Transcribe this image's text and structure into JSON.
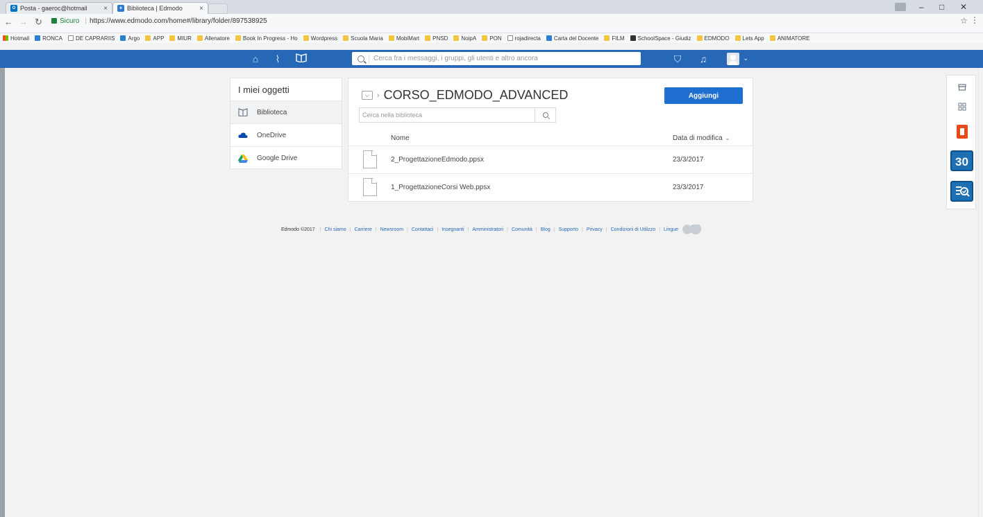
{
  "browser": {
    "tabs": [
      {
        "label": "Posta - gaeroc@hotmail",
        "favicon_color": "#0072c6",
        "favicon_text": "O"
      },
      {
        "label": "Biblioteca | Edmodo",
        "favicon_color": "#2b79d2",
        "favicon_text": "e"
      }
    ],
    "secure_label": "Sicuro",
    "url": "https://www.edmodo.com/home#/library/folder/897538925",
    "bookmarks": [
      {
        "label": "Hotmail",
        "icon": "multi"
      },
      {
        "label": "RONCA",
        "icon": "blue"
      },
      {
        "label": "DE CAPRARIIS",
        "icon": "page"
      },
      {
        "label": "Argo",
        "icon": "blue"
      },
      {
        "label": "APP",
        "icon": "folder"
      },
      {
        "label": "MIUR",
        "icon": "folder"
      },
      {
        "label": "Allenatore",
        "icon": "folder"
      },
      {
        "label": "Book In Progress - Ho",
        "icon": "folder"
      },
      {
        "label": "Wordpress",
        "icon": "folder"
      },
      {
        "label": "Scuola Maria",
        "icon": "folder"
      },
      {
        "label": "MobiMart",
        "icon": "folder"
      },
      {
        "label": "PNSD",
        "icon": "folder"
      },
      {
        "label": "NoipA",
        "icon": "folder"
      },
      {
        "label": "PON",
        "icon": "folder"
      },
      {
        "label": "rojadirecta",
        "icon": "page"
      },
      {
        "label": "Carta del Docente",
        "icon": "blue"
      },
      {
        "label": "FILM",
        "icon": "folder"
      },
      {
        "label": "SchoolSpace - Giudiz",
        "icon": "dark"
      },
      {
        "label": "EDMODO",
        "icon": "folder"
      },
      {
        "label": "Lets App",
        "icon": "folder"
      },
      {
        "label": "ANIMATORE",
        "icon": "folder"
      }
    ]
  },
  "topnav": {
    "search_placeholder": "Cerca fra i messaggi, i gruppi, gli utenti e altro ancora",
    "accent": "#2668b6"
  },
  "sidebar": {
    "title": "I miei oggetti",
    "items": [
      {
        "label": "Biblioteca",
        "icon": "library-icon"
      },
      {
        "label": "OneDrive",
        "icon": "onedrive-icon"
      },
      {
        "label": "Google Drive",
        "icon": "google-drive-icon"
      }
    ]
  },
  "main": {
    "folder_title": "CORSO_EDMODO_ADVANCED",
    "add_label": "Aggiungi",
    "search_placeholder": "Cerca nella biblioteca",
    "columns": {
      "name": "Nome",
      "date": "Data di modifica"
    },
    "files": [
      {
        "name": "2_ProgettazioneEdmodo.ppsx",
        "date": "23/3/2017"
      },
      {
        "name": "1_ProgettazioneCorsi Web.ppsx",
        "date": "23/3/2017"
      }
    ]
  },
  "footer": {
    "copyright": "Edmodo ©2017",
    "links": [
      "Chi siamo",
      "Carriere",
      "Newsroom",
      "Contattaci",
      "Insegnanti",
      "Amministratori",
      "Comunità",
      "Blog",
      "Supporto",
      "Privacy",
      "Condizioni di Utilizzo",
      "Lingue"
    ]
  },
  "dock": {
    "calendar_day": "30"
  }
}
